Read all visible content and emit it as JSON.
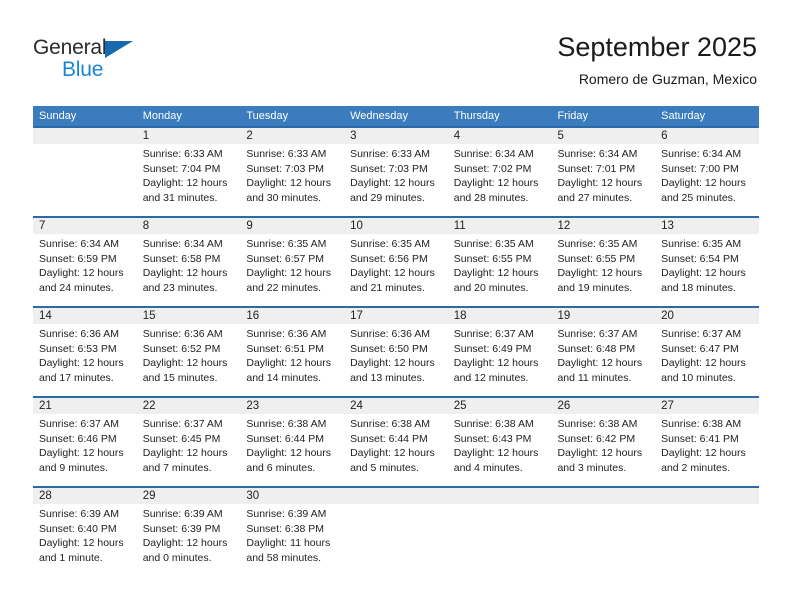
{
  "brand": {
    "name_dark": "General",
    "name_blue": "Blue",
    "accent_color": "#1c86d6",
    "triangle_color": "#1769b0"
  },
  "header": {
    "title": "September 2025",
    "subtitle": "Romero de Guzman, Mexico"
  },
  "theme": {
    "header_row_bg": "#3a7cbe",
    "week_divider": "#2a6aa8",
    "daynum_bg": "#efefef",
    "text_color": "#222222"
  },
  "calendar": {
    "weekdays": [
      "Sunday",
      "Monday",
      "Tuesday",
      "Wednesday",
      "Thursday",
      "Friday",
      "Saturday"
    ],
    "weeks": [
      [
        {
          "day": "",
          "sunrise": "",
          "sunset": "",
          "daylight": "",
          "empty": true
        },
        {
          "day": "1",
          "sunrise": "Sunrise: 6:33 AM",
          "sunset": "Sunset: 7:04 PM",
          "daylight": "Daylight: 12 hours and 31 minutes."
        },
        {
          "day": "2",
          "sunrise": "Sunrise: 6:33 AM",
          "sunset": "Sunset: 7:03 PM",
          "daylight": "Daylight: 12 hours and 30 minutes."
        },
        {
          "day": "3",
          "sunrise": "Sunrise: 6:33 AM",
          "sunset": "Sunset: 7:03 PM",
          "daylight": "Daylight: 12 hours and 29 minutes."
        },
        {
          "day": "4",
          "sunrise": "Sunrise: 6:34 AM",
          "sunset": "Sunset: 7:02 PM",
          "daylight": "Daylight: 12 hours and 28 minutes."
        },
        {
          "day": "5",
          "sunrise": "Sunrise: 6:34 AM",
          "sunset": "Sunset: 7:01 PM",
          "daylight": "Daylight: 12 hours and 27 minutes."
        },
        {
          "day": "6",
          "sunrise": "Sunrise: 6:34 AM",
          "sunset": "Sunset: 7:00 PM",
          "daylight": "Daylight: 12 hours and 25 minutes."
        }
      ],
      [
        {
          "day": "7",
          "sunrise": "Sunrise: 6:34 AM",
          "sunset": "Sunset: 6:59 PM",
          "daylight": "Daylight: 12 hours and 24 minutes."
        },
        {
          "day": "8",
          "sunrise": "Sunrise: 6:34 AM",
          "sunset": "Sunset: 6:58 PM",
          "daylight": "Daylight: 12 hours and 23 minutes."
        },
        {
          "day": "9",
          "sunrise": "Sunrise: 6:35 AM",
          "sunset": "Sunset: 6:57 PM",
          "daylight": "Daylight: 12 hours and 22 minutes."
        },
        {
          "day": "10",
          "sunrise": "Sunrise: 6:35 AM",
          "sunset": "Sunset: 6:56 PM",
          "daylight": "Daylight: 12 hours and 21 minutes."
        },
        {
          "day": "11",
          "sunrise": "Sunrise: 6:35 AM",
          "sunset": "Sunset: 6:55 PM",
          "daylight": "Daylight: 12 hours and 20 minutes."
        },
        {
          "day": "12",
          "sunrise": "Sunrise: 6:35 AM",
          "sunset": "Sunset: 6:55 PM",
          "daylight": "Daylight: 12 hours and 19 minutes."
        },
        {
          "day": "13",
          "sunrise": "Sunrise: 6:35 AM",
          "sunset": "Sunset: 6:54 PM",
          "daylight": "Daylight: 12 hours and 18 minutes."
        }
      ],
      [
        {
          "day": "14",
          "sunrise": "Sunrise: 6:36 AM",
          "sunset": "Sunset: 6:53 PM",
          "daylight": "Daylight: 12 hours and 17 minutes."
        },
        {
          "day": "15",
          "sunrise": "Sunrise: 6:36 AM",
          "sunset": "Sunset: 6:52 PM",
          "daylight": "Daylight: 12 hours and 15 minutes."
        },
        {
          "day": "16",
          "sunrise": "Sunrise: 6:36 AM",
          "sunset": "Sunset: 6:51 PM",
          "daylight": "Daylight: 12 hours and 14 minutes."
        },
        {
          "day": "17",
          "sunrise": "Sunrise: 6:36 AM",
          "sunset": "Sunset: 6:50 PM",
          "daylight": "Daylight: 12 hours and 13 minutes."
        },
        {
          "day": "18",
          "sunrise": "Sunrise: 6:37 AM",
          "sunset": "Sunset: 6:49 PM",
          "daylight": "Daylight: 12 hours and 12 minutes."
        },
        {
          "day": "19",
          "sunrise": "Sunrise: 6:37 AM",
          "sunset": "Sunset: 6:48 PM",
          "daylight": "Daylight: 12 hours and 11 minutes."
        },
        {
          "day": "20",
          "sunrise": "Sunrise: 6:37 AM",
          "sunset": "Sunset: 6:47 PM",
          "daylight": "Daylight: 12 hours and 10 minutes."
        }
      ],
      [
        {
          "day": "21",
          "sunrise": "Sunrise: 6:37 AM",
          "sunset": "Sunset: 6:46 PM",
          "daylight": "Daylight: 12 hours and 9 minutes."
        },
        {
          "day": "22",
          "sunrise": "Sunrise: 6:37 AM",
          "sunset": "Sunset: 6:45 PM",
          "daylight": "Daylight: 12 hours and 7 minutes."
        },
        {
          "day": "23",
          "sunrise": "Sunrise: 6:38 AM",
          "sunset": "Sunset: 6:44 PM",
          "daylight": "Daylight: 12 hours and 6 minutes."
        },
        {
          "day": "24",
          "sunrise": "Sunrise: 6:38 AM",
          "sunset": "Sunset: 6:44 PM",
          "daylight": "Daylight: 12 hours and 5 minutes."
        },
        {
          "day": "25",
          "sunrise": "Sunrise: 6:38 AM",
          "sunset": "Sunset: 6:43 PM",
          "daylight": "Daylight: 12 hours and 4 minutes."
        },
        {
          "day": "26",
          "sunrise": "Sunrise: 6:38 AM",
          "sunset": "Sunset: 6:42 PM",
          "daylight": "Daylight: 12 hours and 3 minutes."
        },
        {
          "day": "27",
          "sunrise": "Sunrise: 6:38 AM",
          "sunset": "Sunset: 6:41 PM",
          "daylight": "Daylight: 12 hours and 2 minutes."
        }
      ],
      [
        {
          "day": "28",
          "sunrise": "Sunrise: 6:39 AM",
          "sunset": "Sunset: 6:40 PM",
          "daylight": "Daylight: 12 hours and 1 minute."
        },
        {
          "day": "29",
          "sunrise": "Sunrise: 6:39 AM",
          "sunset": "Sunset: 6:39 PM",
          "daylight": "Daylight: 12 hours and 0 minutes."
        },
        {
          "day": "30",
          "sunrise": "Sunrise: 6:39 AM",
          "sunset": "Sunset: 6:38 PM",
          "daylight": "Daylight: 11 hours and 58 minutes."
        },
        {
          "day": "",
          "sunrise": "",
          "sunset": "",
          "daylight": "",
          "empty": true
        },
        {
          "day": "",
          "sunrise": "",
          "sunset": "",
          "daylight": "",
          "empty": true
        },
        {
          "day": "",
          "sunrise": "",
          "sunset": "",
          "daylight": "",
          "empty": true
        },
        {
          "day": "",
          "sunrise": "",
          "sunset": "",
          "daylight": "",
          "empty": true
        }
      ]
    ]
  }
}
